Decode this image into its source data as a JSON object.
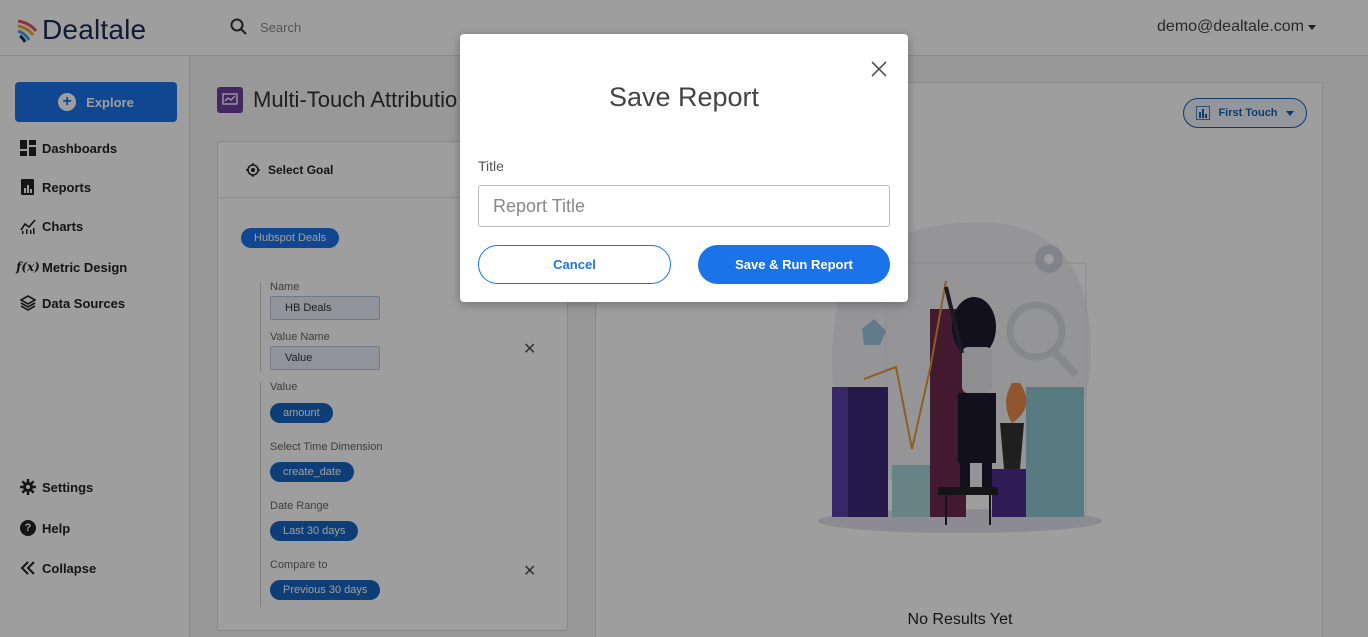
{
  "app": {
    "brand": "Dealtale",
    "user_email": "demo@dealtale.com"
  },
  "search": {
    "placeholder": "Search"
  },
  "sidebar": {
    "explore_label": "Explore",
    "items": [
      {
        "label": "Dashboards",
        "icon": "dashboard-icon"
      },
      {
        "label": "Reports",
        "icon": "report-icon"
      },
      {
        "label": "Charts",
        "icon": "chart-icon"
      },
      {
        "label": "Metric Design",
        "icon": "function-icon"
      },
      {
        "label": "Data Sources",
        "icon": "layers-icon"
      }
    ],
    "bottom": [
      {
        "label": "Settings",
        "icon": "gear-icon"
      },
      {
        "label": "Help",
        "icon": "help-icon"
      },
      {
        "label": "Collapse",
        "icon": "collapse-icon"
      }
    ]
  },
  "page": {
    "title": "Multi-Touch Attributio"
  },
  "goal": {
    "header": "Select Goal",
    "source": "Hubspot Deals",
    "name_label": "Name",
    "name_value": "HB Deals",
    "value_name_label": "Value Name",
    "value_name_value": "Value",
    "value_label": "Value",
    "value_value": "amount",
    "time_dim_label": "Select Time Dimension",
    "time_dim_value": "create_date",
    "date_range_label": "Date Range",
    "date_range_value": "Last 30 days",
    "compare_label": "Compare to",
    "compare_value": "Previous 30 days"
  },
  "results": {
    "touch_model": "First Touch",
    "empty_text": "No Results Yet"
  },
  "modal": {
    "title": "Save Report",
    "field_label": "Title",
    "placeholder": "Report Title",
    "cancel_label": "Cancel",
    "save_label": "Save & Run Report"
  }
}
